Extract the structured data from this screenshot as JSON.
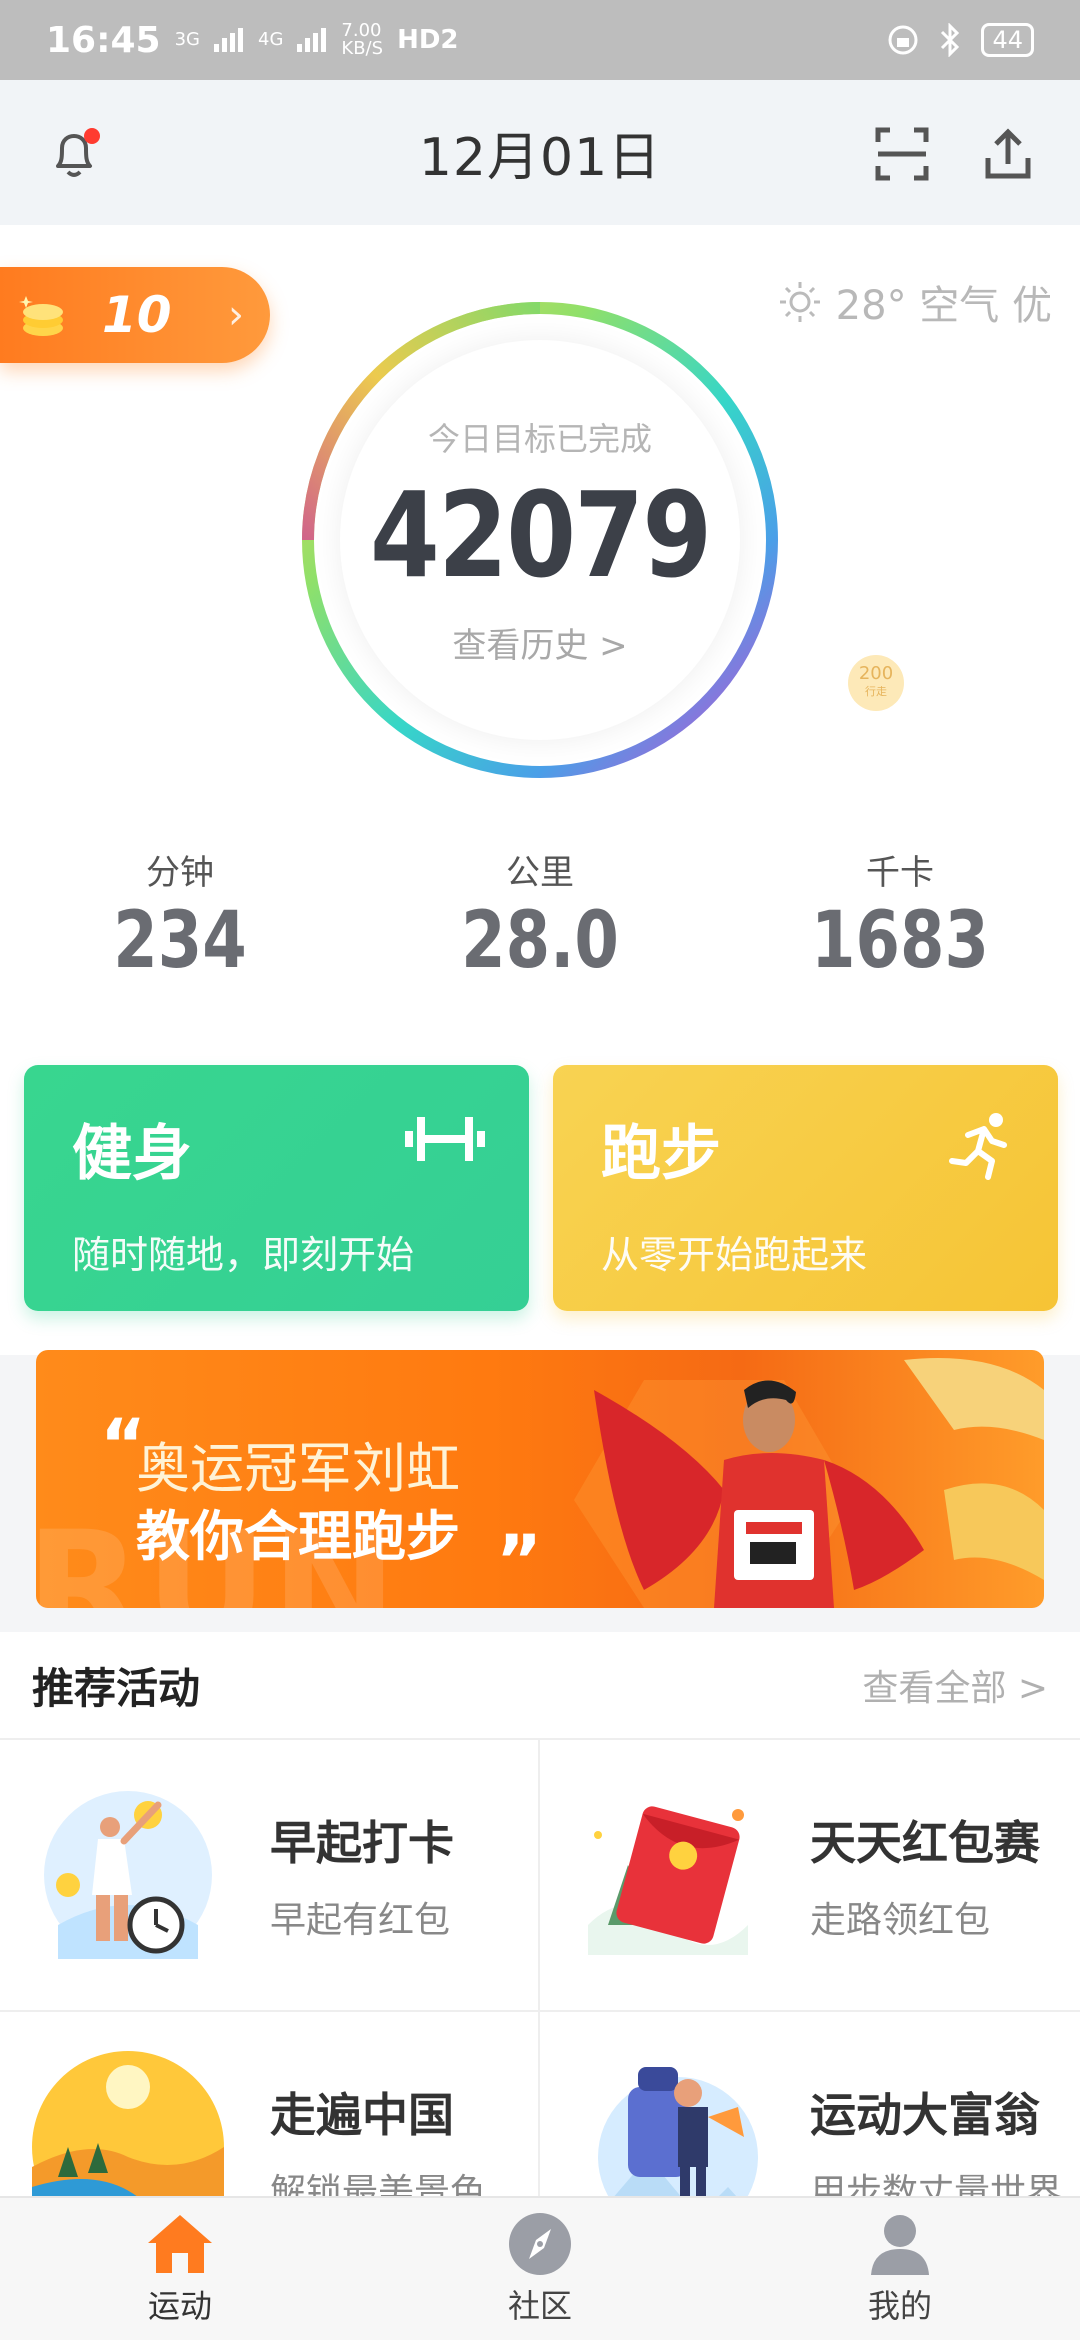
{
  "status_bar": {
    "time": "16:45",
    "net1": "3G",
    "net2": "4G",
    "speed": "7.00\nKB/S",
    "hd": "HD2",
    "battery": "44"
  },
  "header": {
    "date": "12月01日"
  },
  "coins": {
    "value": "10"
  },
  "weather": {
    "text": "28° 空气 优"
  },
  "ring": {
    "goal_text": "今日目标已完成",
    "steps": "42079",
    "history_link": "查看历史 >"
  },
  "bubble": {
    "value": "200",
    "label": "行走"
  },
  "stats": [
    {
      "label": "分钟",
      "value": "234"
    },
    {
      "label": "公里",
      "value": "28.0"
    },
    {
      "label": "千卡",
      "value": "1683"
    }
  ],
  "cards": [
    {
      "title": "健身",
      "subtitle": "随时随地，即刻开始",
      "icon": "dumbbell-icon"
    },
    {
      "title": "跑步",
      "subtitle": "从零开始跑起来",
      "icon": "runner-icon"
    }
  ],
  "banner": {
    "line1": "奥运冠军刘虹",
    "line2": "教你合理跑步",
    "bg_text": "RUN"
  },
  "recommended": {
    "title": "推荐活动",
    "more": "查看全部 >",
    "items": [
      {
        "name": "早起打卡",
        "desc": "早起有红包",
        "art": "morning-alarm-art"
      },
      {
        "name": "天天红包赛",
        "desc": "走路领红包",
        "art": "red-envelope-art"
      },
      {
        "name": "走遍中国",
        "desc": "解锁最美景色",
        "art": "landscape-art"
      },
      {
        "name": "运动大富翁",
        "desc": "用步数丈量世界",
        "art": "traveler-art"
      }
    ]
  },
  "tabs": [
    {
      "label": "运动",
      "icon": "home-icon",
      "active": true
    },
    {
      "label": "社区",
      "icon": "compass-icon",
      "active": false
    },
    {
      "label": "我的",
      "icon": "profile-icon",
      "active": false
    }
  ],
  "colors": {
    "accent": "#ff7b1f",
    "green": "#35cf95",
    "yellow": "#f6c435"
  }
}
